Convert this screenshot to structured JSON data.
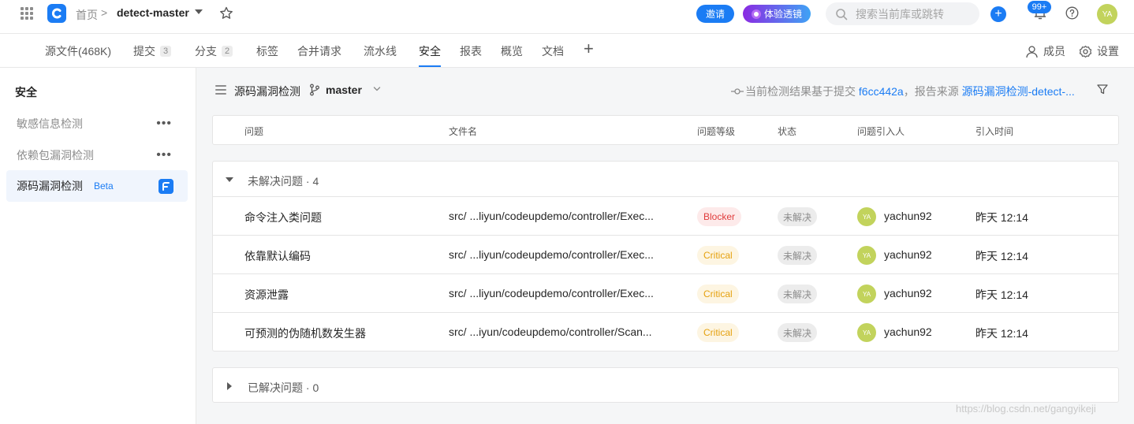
{
  "topbar": {
    "home": "首页",
    "separator": ">",
    "repo": "detect-master",
    "invite_label": "邀请",
    "lens_label": "体验透镜",
    "search_placeholder": "搜索当前库或跳转",
    "add_label": "+",
    "notification_badge": "99+",
    "user_initials": "YA"
  },
  "tabs": [
    {
      "label": "源文件(468K)"
    },
    {
      "label": "提交",
      "count": "3"
    },
    {
      "label": "分支",
      "count": "2"
    },
    {
      "label": "标签"
    },
    {
      "label": "合并请求"
    },
    {
      "label": "流水线"
    },
    {
      "label": "安全",
      "active": true
    },
    {
      "label": "报表"
    },
    {
      "label": "概览"
    },
    {
      "label": "文档"
    }
  ],
  "tab_add": "+",
  "tab_actions": {
    "members": "成员",
    "settings": "设置"
  },
  "sidebar": {
    "title": "安全",
    "items": [
      {
        "label": "敏感信息检测",
        "more": "•••"
      },
      {
        "label": "依赖包漏洞检测",
        "more": "•••"
      },
      {
        "label": "源码漏洞检测",
        "tag": "Beta",
        "active": true
      }
    ]
  },
  "subheader": {
    "title": "源码漏洞检测",
    "branch": "master",
    "commit_prefix": "当前检测结果基于提交",
    "commit_id": "f6cc442a",
    "report_prefix": "，报告来源",
    "report_source": "源码漏洞检测-detect-..."
  },
  "table_headers": {
    "issue": "问题",
    "file": "文件名",
    "level": "问题等级",
    "status": "状态",
    "introducer": "问题引入人",
    "time": "引入时间"
  },
  "unresolved": {
    "title": "未解决问题 · 4",
    "rows": [
      {
        "issue": "命令注入类问题",
        "file": "src/ ...liyun/codeupdemo/controller/Exec...",
        "level": "Blocker",
        "status": "未解决",
        "initials": "YA",
        "user": "yachun92",
        "time": "昨天 12:14"
      },
      {
        "issue": "依靠默认编码",
        "file": "src/ ...liyun/codeupdemo/controller/Exec...",
        "level": "Critical",
        "status": "未解决",
        "initials": "YA",
        "user": "yachun92",
        "time": "昨天 12:14"
      },
      {
        "issue": "资源泄露",
        "file": "src/ ...liyun/codeupdemo/controller/Exec...",
        "level": "Critical",
        "status": "未解决",
        "initials": "YA",
        "user": "yachun92",
        "time": "昨天 12:14"
      },
      {
        "issue": "可预测的伪随机数发生器",
        "file": "src/ ...iyun/codeupdemo/controller/Scan...",
        "level": "Critical",
        "status": "未解决",
        "initials": "YA",
        "user": "yachun92",
        "time": "昨天 12:14"
      }
    ]
  },
  "resolved": {
    "title": "已解决问题 · 0"
  },
  "watermark": "https://blog.csdn.net/gangyikeji",
  "colors": {
    "accent": "#1b7cf4",
    "blocker": "#e03c3c",
    "critical": "#e5a10f",
    "avatar": "#c2d35c"
  }
}
